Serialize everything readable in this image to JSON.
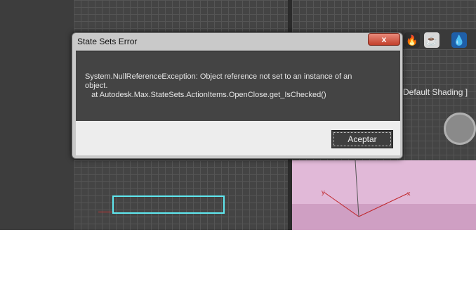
{
  "dialog": {
    "title": "State Sets Error",
    "close_label": "x",
    "message_lines": [
      "System.NullReferenceException: Object reference not set to an instance of an",
      "object.",
      "   at Autodesk.Max.StateSets.ActionItems.OpenClose.get_IsChecked()"
    ],
    "ok_label": "Aceptar"
  },
  "viewport": {
    "shading_label": "Default Shading ]"
  },
  "toolbar": {
    "icons": [
      "fire-icon",
      "teapot-icon",
      "water-drop-icon"
    ]
  },
  "colors": {
    "accent_close": "#c3402c",
    "selection": "#5fe8f0",
    "object": "#e1b9d8"
  }
}
